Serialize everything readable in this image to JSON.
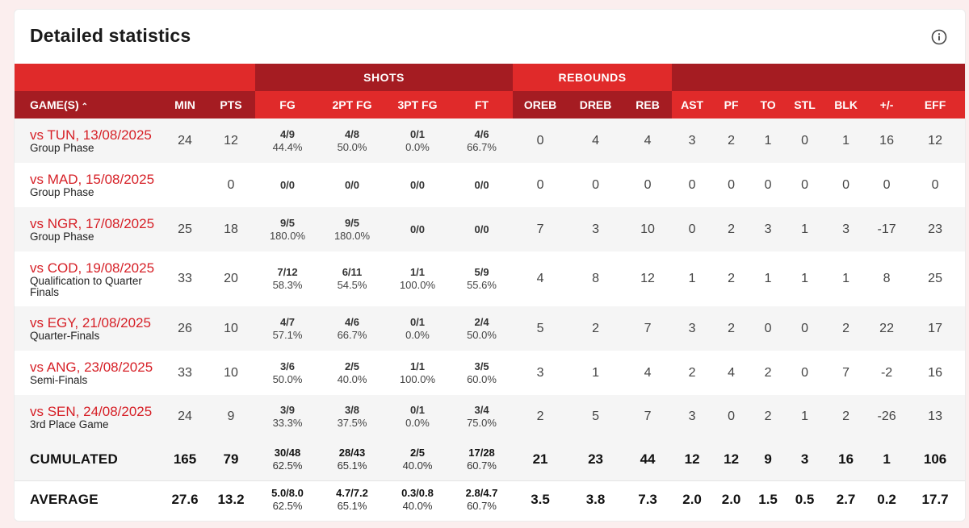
{
  "title": "Detailed statistics",
  "groups": {
    "shots": "SHOTS",
    "rebounds": "REBOUNDS"
  },
  "columns": [
    "GAME(S)",
    "MIN",
    "PTS",
    "FG",
    "2PT FG",
    "3PT FG",
    "FT",
    "OREB",
    "DREB",
    "REB",
    "AST",
    "PF",
    "TO",
    "STL",
    "BLK",
    "+/-",
    "EFF"
  ],
  "games": [
    {
      "opponent": "vs TUN, 13/08/2025",
      "phase": "Group Phase",
      "min": "24",
      "pts": "12",
      "fg": {
        "made": "4/9",
        "pct": "44.4%"
      },
      "fg2": {
        "made": "4/8",
        "pct": "50.0%"
      },
      "fg3": {
        "made": "0/1",
        "pct": "0.0%"
      },
      "ft": {
        "made": "4/6",
        "pct": "66.7%"
      },
      "oreb": "0",
      "dreb": "4",
      "reb": "4",
      "ast": "3",
      "pf": "2",
      "to": "1",
      "stl": "0",
      "blk": "1",
      "pm": "16",
      "eff": "12"
    },
    {
      "opponent": "vs MAD, 15/08/2025",
      "phase": "Group Phase",
      "min": "",
      "pts": "0",
      "fg": {
        "made": "0/0",
        "pct": ""
      },
      "fg2": {
        "made": "0/0",
        "pct": ""
      },
      "fg3": {
        "made": "0/0",
        "pct": ""
      },
      "ft": {
        "made": "0/0",
        "pct": ""
      },
      "oreb": "0",
      "dreb": "0",
      "reb": "0",
      "ast": "0",
      "pf": "0",
      "to": "0",
      "stl": "0",
      "blk": "0",
      "pm": "0",
      "eff": "0"
    },
    {
      "opponent": "vs NGR, 17/08/2025",
      "phase": "Group Phase",
      "min": "25",
      "pts": "18",
      "fg": {
        "made": "9/5",
        "pct": "180.0%"
      },
      "fg2": {
        "made": "9/5",
        "pct": "180.0%"
      },
      "fg3": {
        "made": "0/0",
        "pct": ""
      },
      "ft": {
        "made": "0/0",
        "pct": ""
      },
      "oreb": "7",
      "dreb": "3",
      "reb": "10",
      "ast": "0",
      "pf": "2",
      "to": "3",
      "stl": "1",
      "blk": "3",
      "pm": "-17",
      "eff": "23"
    },
    {
      "opponent": "vs COD, 19/08/2025",
      "phase": "Qualification to Quarter Finals",
      "min": "33",
      "pts": "20",
      "fg": {
        "made": "7/12",
        "pct": "58.3%"
      },
      "fg2": {
        "made": "6/11",
        "pct": "54.5%"
      },
      "fg3": {
        "made": "1/1",
        "pct": "100.0%"
      },
      "ft": {
        "made": "5/9",
        "pct": "55.6%"
      },
      "oreb": "4",
      "dreb": "8",
      "reb": "12",
      "ast": "1",
      "pf": "2",
      "to": "1",
      "stl": "1",
      "blk": "1",
      "pm": "8",
      "eff": "25"
    },
    {
      "opponent": "vs EGY, 21/08/2025",
      "phase": "Quarter-Finals",
      "min": "26",
      "pts": "10",
      "fg": {
        "made": "4/7",
        "pct": "57.1%"
      },
      "fg2": {
        "made": "4/6",
        "pct": "66.7%"
      },
      "fg3": {
        "made": "0/1",
        "pct": "0.0%"
      },
      "ft": {
        "made": "2/4",
        "pct": "50.0%"
      },
      "oreb": "5",
      "dreb": "2",
      "reb": "7",
      "ast": "3",
      "pf": "2",
      "to": "0",
      "stl": "0",
      "blk": "2",
      "pm": "22",
      "eff": "17"
    },
    {
      "opponent": "vs ANG, 23/08/2025",
      "phase": "Semi-Finals",
      "min": "33",
      "pts": "10",
      "fg": {
        "made": "3/6",
        "pct": "50.0%"
      },
      "fg2": {
        "made": "2/5",
        "pct": "40.0%"
      },
      "fg3": {
        "made": "1/1",
        "pct": "100.0%"
      },
      "ft": {
        "made": "3/5",
        "pct": "60.0%"
      },
      "oreb": "3",
      "dreb": "1",
      "reb": "4",
      "ast": "2",
      "pf": "4",
      "to": "2",
      "stl": "0",
      "blk": "7",
      "pm": "-2",
      "eff": "16"
    },
    {
      "opponent": "vs SEN, 24/08/2025",
      "phase": "3rd Place Game",
      "min": "24",
      "pts": "9",
      "fg": {
        "made": "3/9",
        "pct": "33.3%"
      },
      "fg2": {
        "made": "3/8",
        "pct": "37.5%"
      },
      "fg3": {
        "made": "0/1",
        "pct": "0.0%"
      },
      "ft": {
        "made": "3/4",
        "pct": "75.0%"
      },
      "oreb": "2",
      "dreb": "5",
      "reb": "7",
      "ast": "3",
      "pf": "0",
      "to": "2",
      "stl": "1",
      "blk": "2",
      "pm": "-26",
      "eff": "13"
    }
  ],
  "cumulated": {
    "label": "CUMULATED",
    "min": "165",
    "pts": "79",
    "fg": {
      "made": "30/48",
      "pct": "62.5%"
    },
    "fg2": {
      "made": "28/43",
      "pct": "65.1%"
    },
    "fg3": {
      "made": "2/5",
      "pct": "40.0%"
    },
    "ft": {
      "made": "17/28",
      "pct": "60.7%"
    },
    "oreb": "21",
    "dreb": "23",
    "reb": "44",
    "ast": "12",
    "pf": "12",
    "to": "9",
    "stl": "3",
    "blk": "16",
    "pm": "1",
    "eff": "106"
  },
  "average": {
    "label": "AVERAGE",
    "min": "27.6",
    "pts": "13.2",
    "fg": {
      "made": "5.0/8.0",
      "pct": "62.5%"
    },
    "fg2": {
      "made": "4.7/7.2",
      "pct": "65.1%"
    },
    "fg3": {
      "made": "0.3/0.8",
      "pct": "40.0%"
    },
    "ft": {
      "made": "2.8/4.7",
      "pct": "60.7%"
    },
    "oreb": "3.5",
    "dreb": "3.8",
    "reb": "7.3",
    "ast": "2.0",
    "pf": "2.0",
    "to": "1.5",
    "stl": "0.5",
    "blk": "2.7",
    "pm": "0.2",
    "eff": "17.7"
  },
  "colors": {
    "red": "#e02a2a",
    "dark_red": "#a51c22",
    "link": "#d61f26"
  },
  "icons": {
    "info": "info-icon",
    "sort": "chevron-up-icon"
  }
}
